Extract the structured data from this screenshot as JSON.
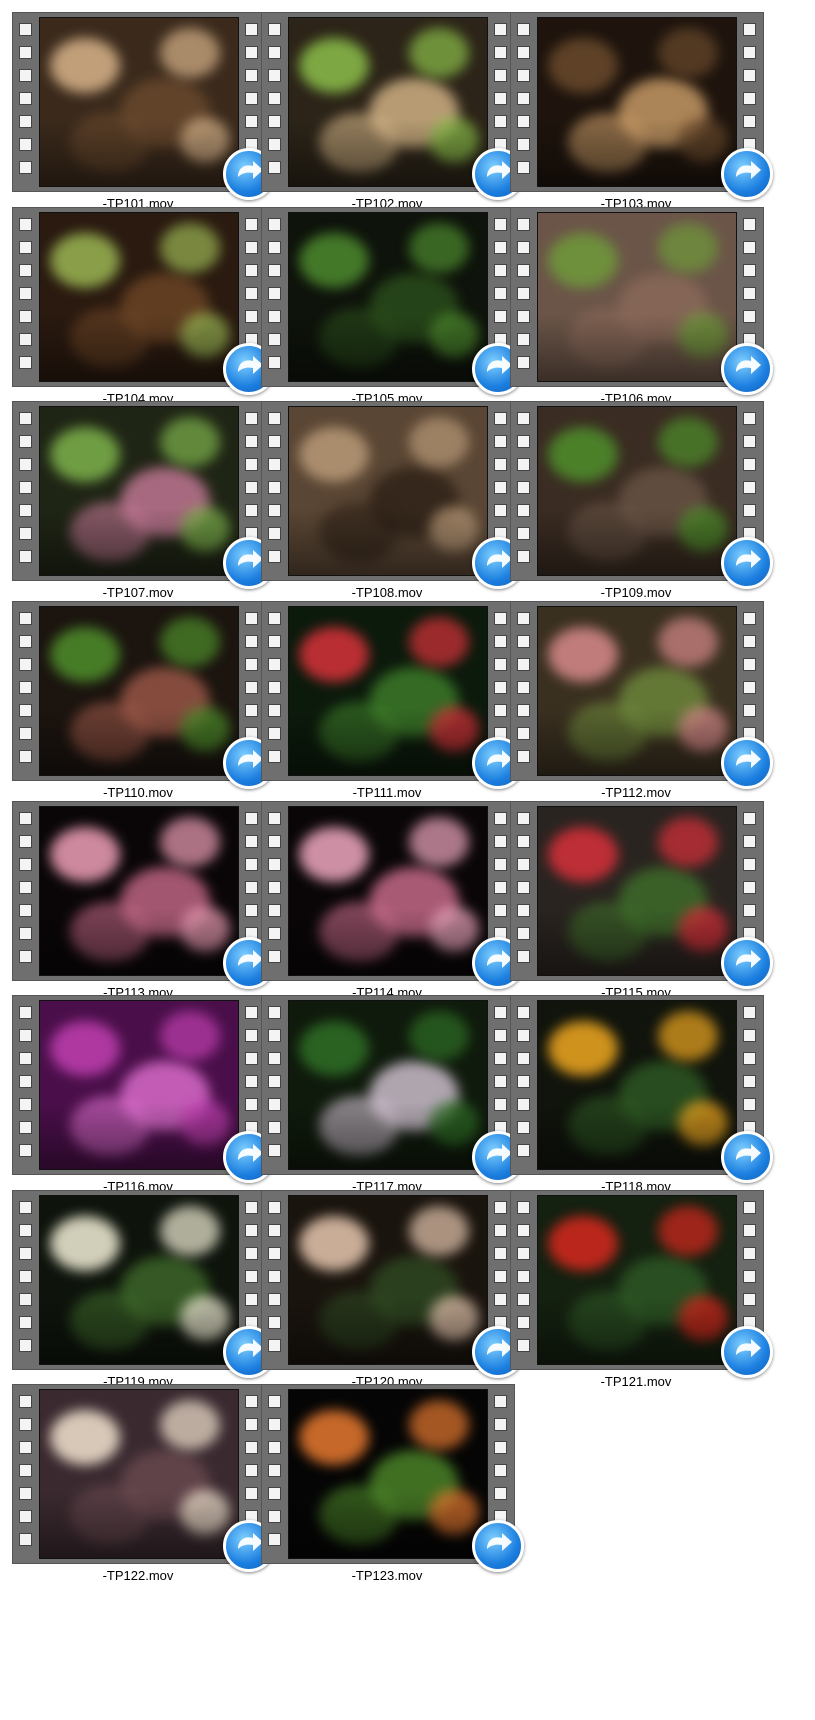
{
  "files": [
    {
      "name": "-TP101.mov",
      "thumb": {
        "bg": "#3b2a1c",
        "accent": "#d8b48a",
        "accent2": "#6b4a2e"
      }
    },
    {
      "name": "-TP102.mov",
      "thumb": {
        "bg": "#2c2418",
        "accent": "#8cbf4a",
        "accent2": "#d9b98a"
      }
    },
    {
      "name": "-TP103.mov",
      "thumb": {
        "bg": "#1e140d",
        "accent": "#6a4a2c",
        "accent2": "#cfa06a"
      }
    },
    {
      "name": "-TP104.mov",
      "thumb": {
        "bg": "#2a1a10",
        "accent": "#9bb653",
        "accent2": "#6e4626"
      }
    },
    {
      "name": "-TP105.mov",
      "thumb": {
        "bg": "#0e130b",
        "accent": "#4d8a2e",
        "accent2": "#2b4f1c"
      }
    },
    {
      "name": "-TP106.mov",
      "thumb": {
        "bg": "#6b5548",
        "accent": "#6f9a3a",
        "accent2": "#8b6a5a"
      }
    },
    {
      "name": "-TP107.mov",
      "thumb": {
        "bg": "#1f2515",
        "accent": "#7eb34c",
        "accent2": "#c97b9a"
      }
    },
    {
      "name": "-TP108.mov",
      "thumb": {
        "bg": "#5a4634",
        "accent": "#b99a78",
        "accent2": "#2d2016"
      }
    },
    {
      "name": "-TP109.mov",
      "thumb": {
        "bg": "#3a2c22",
        "accent": "#4f8f2b",
        "accent2": "#6a5446"
      }
    },
    {
      "name": "-TP110.mov",
      "thumb": {
        "bg": "#1b140f",
        "accent": "#4f8f2b",
        "accent2": "#a05a4a"
      }
    },
    {
      "name": "-TP111.mov",
      "thumb": {
        "bg": "#0c1a0c",
        "accent": "#d8323a",
        "accent2": "#3f7f2a"
      }
    },
    {
      "name": "-TP112.mov",
      "thumb": {
        "bg": "#3a3020",
        "accent": "#d88a8a",
        "accent2": "#6f8a3c"
      }
    },
    {
      "name": "-TP113.mov",
      "thumb": {
        "bg": "#0a0608",
        "accent": "#f0a0b8",
        "accent2": "#c86a8a"
      }
    },
    {
      "name": "-TP114.mov",
      "thumb": {
        "bg": "#0a0608",
        "accent": "#f0a8c0",
        "accent2": "#d07090"
      }
    },
    {
      "name": "-TP115.mov",
      "thumb": {
        "bg": "#2a2420",
        "accent": "#d8303a",
        "accent2": "#3f6f2a"
      }
    },
    {
      "name": "-TP116.mov",
      "thumb": {
        "bg": "#4a0f4a",
        "accent": "#c03fb0",
        "accent2": "#e070d0"
      }
    },
    {
      "name": "-TP117.mov",
      "thumb": {
        "bg": "#0f1a0c",
        "accent": "#2f6f26",
        "accent2": "#d8c8d8"
      }
    },
    {
      "name": "-TP118.mov",
      "thumb": {
        "bg": "#10140c",
        "accent": "#f0a820",
        "accent2": "#2f5a24"
      }
    },
    {
      "name": "-TP119.mov",
      "thumb": {
        "bg": "#0e140c",
        "accent": "#f4f0d8",
        "accent2": "#3f6a2a"
      }
    },
    {
      "name": "-TP120.mov",
      "thumb": {
        "bg": "#1a140e",
        "accent": "#e8c8b0",
        "accent2": "#2f4a22"
      }
    },
    {
      "name": "-TP121.mov",
      "thumb": {
        "bg": "#142010",
        "accent": "#d8281e",
        "accent2": "#2f5a26"
      }
    },
    {
      "name": "-TP122.mov",
      "thumb": {
        "bg": "#3a2a30",
        "accent": "#f4e4d0",
        "accent2": "#6a4a50"
      }
    },
    {
      "name": "-TP123.mov",
      "thumb": {
        "bg": "#050505",
        "accent": "#e87a30",
        "accent2": "#4f8a2a"
      }
    }
  ]
}
